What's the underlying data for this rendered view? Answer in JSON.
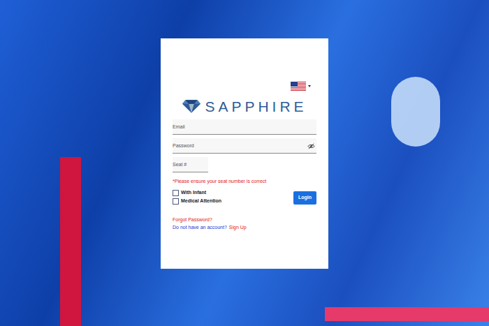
{
  "logo": {
    "text": "SAPPHIRE"
  },
  "fields": [
    {
      "label": "Email",
      "kind": "text"
    },
    {
      "label": "Password",
      "kind": "password"
    },
    {
      "label": "Seat #",
      "kind": "seat"
    }
  ],
  "notice": "*Please ensure your seat number is correct",
  "options": [
    {
      "label": "With Infant",
      "checked": false
    },
    {
      "label": "Medical Attention",
      "checked": false
    }
  ],
  "login_button": "Login",
  "forgot_link": "Forgot Password?",
  "signup": {
    "prompt": "Do not have an account?",
    "link": "Sign Up"
  }
}
